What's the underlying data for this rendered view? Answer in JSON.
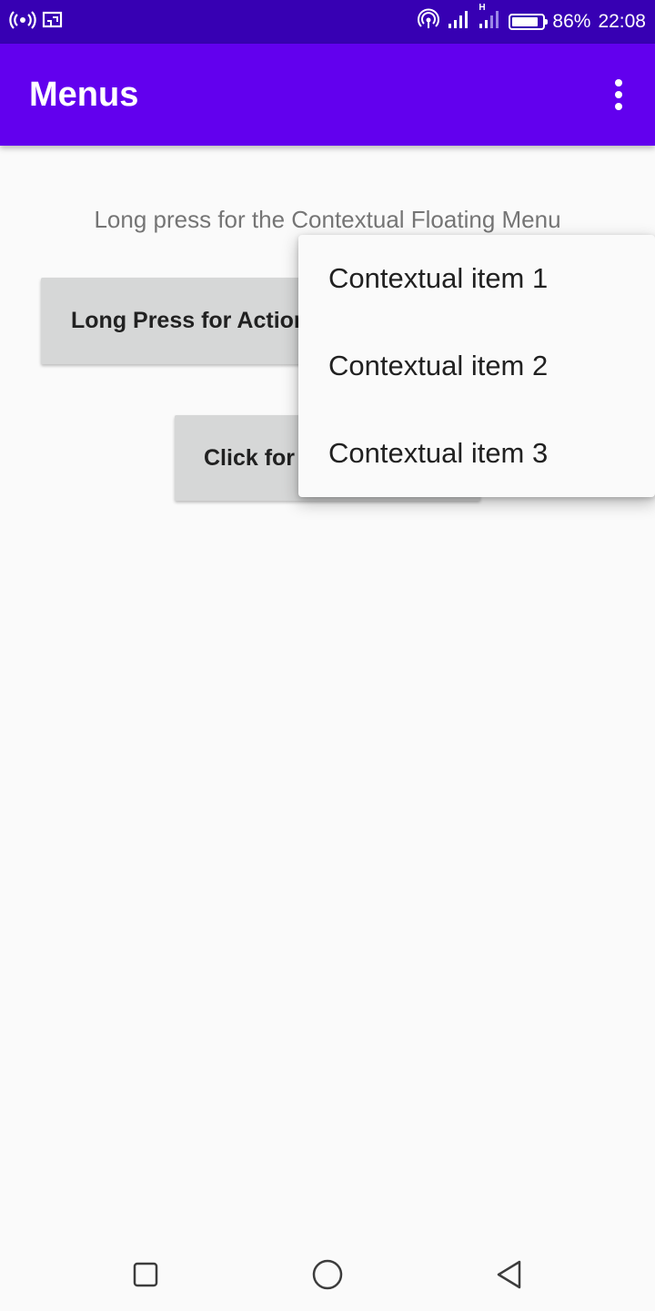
{
  "status_bar": {
    "battery_percent_text": "86%",
    "battery_level": 0.86,
    "time": "22:08",
    "network_type": "H",
    "icons": [
      "broadcast-icon",
      "cast-icon",
      "hotspot-icon",
      "signal-icon",
      "signal-icon-2",
      "battery-icon"
    ]
  },
  "app_bar": {
    "title": "Menus",
    "overflow_icon": "more-vert-icon",
    "background": "#6200ee"
  },
  "content": {
    "hint": "Long press for the Contextual Floating Menu",
    "action_button_label": "Long Press for Action Mode",
    "popup_button_label": "Click for Popup Menu"
  },
  "context_menu": {
    "items": [
      {
        "label": "Contextual item 1"
      },
      {
        "label": "Contextual item 2"
      },
      {
        "label": "Contextual item 3"
      }
    ]
  },
  "nav_bar": {
    "icons": [
      "recents-icon",
      "home-icon",
      "back-icon"
    ]
  },
  "colors": {
    "status_bar": "#3700b3",
    "app_bar": "#6200ee",
    "background": "#fafafa",
    "button": "#d6d7d7"
  }
}
